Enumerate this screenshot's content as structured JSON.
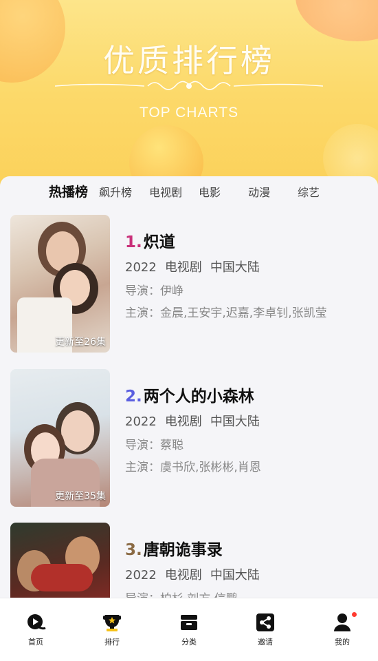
{
  "banner": {
    "title": "优质排行榜",
    "subtitle": "TOP CHARTS"
  },
  "tabs": [
    {
      "label": "热播榜",
      "active": true
    },
    {
      "label": "飙升榜",
      "active": false
    },
    {
      "label": "电视剧",
      "active": false
    },
    {
      "label": "电影",
      "active": false
    },
    {
      "label": "动漫",
      "active": false
    },
    {
      "label": "综艺",
      "active": false
    }
  ],
  "list": [
    {
      "rank": "1.",
      "rank_color": "#c9307a",
      "title": "炽道",
      "year": "2022",
      "genre": "电视剧",
      "region": "中国大陆",
      "director": "导演：伊峥",
      "cast": "主演：金晨,王安宇,迟嘉,李卓钊,张凯莹",
      "episodes": "更新至26集"
    },
    {
      "rank": "2.",
      "rank_color": "#5b5fe0",
      "title": "两个人的小森林",
      "year": "2022",
      "genre": "电视剧",
      "region": "中国大陆",
      "director": "导演：蔡聪",
      "cast": "主演：虞书欣,张彬彬,肖恩",
      "episodes": "更新至35集"
    },
    {
      "rank": "3.",
      "rank_color": "#8a6a44",
      "title": "唐朝诡事录",
      "year": "2022",
      "genre": "电视剧",
      "region": "中国大陆",
      "director": "导演：柏杉,刘方,信鹏",
      "cast": "",
      "episodes": ""
    }
  ],
  "navbar": [
    {
      "label": "首页",
      "icon": "home-play-icon"
    },
    {
      "label": "排行",
      "icon": "trophy-icon",
      "active": true
    },
    {
      "label": "分类",
      "icon": "category-box-icon"
    },
    {
      "label": "邀请",
      "icon": "share-icon"
    },
    {
      "label": "我的",
      "icon": "user-icon",
      "badge": true
    }
  ]
}
